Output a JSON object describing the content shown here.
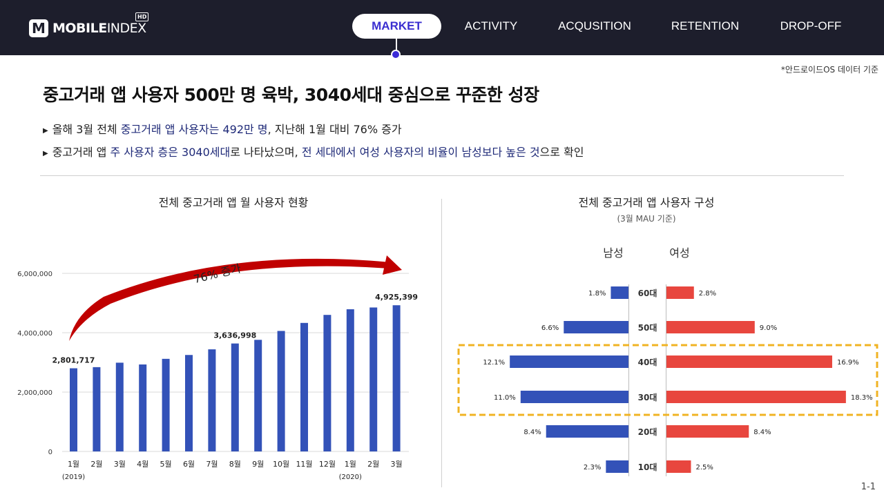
{
  "brand": {
    "name_bold": "MOBILE",
    "name_light": "INDEX",
    "badge": "HD",
    "mark": "M"
  },
  "nav": [
    "MARKET",
    "ACTIVITY",
    "ACQUSITION",
    "RETENTION",
    "DROP-OFF"
  ],
  "note": "*안드로이드OS 데이터 기준",
  "headline": "중고거래 앱 사용자 500만 명 육박, 3040세대 중심으로 꾸준한 성장",
  "bullets": [
    {
      "p1": "올해 3월 전체 ",
      "h1": "중고거래 앱 사용자는 492만 명",
      "p2": ", 지난해 1월 대비 76% 증가"
    },
    {
      "p1": "중고거래 앱  ",
      "h1": "주 사용자 층은 3040세대",
      "p2": "로 나타났으며, ",
      "h2": "전 세대에서 여성 사용자의 비율이 남성보다 높은 것",
      "p3": "으로 확인"
    }
  ],
  "page_number": "1-1",
  "colors": {
    "bar_blue": "#3352b8",
    "bar_red": "#e8463e",
    "highlight_box": "#f0b323",
    "arrow": "#c00000"
  },
  "chart_data": [
    {
      "type": "bar",
      "title": "전체 중고거래 앱 월 사용자 현황",
      "categories": [
        "1월",
        "2월",
        "3월",
        "4월",
        "5월",
        "6월",
        "7월",
        "8월",
        "9월",
        "10월",
        "11월",
        "12월",
        "1월",
        "2월",
        "3월"
      ],
      "year_labels": [
        "(2019)",
        "(2020)"
      ],
      "values": [
        2801717,
        2840000,
        2990000,
        2930000,
        3120000,
        3250000,
        3440000,
        3636998,
        3760000,
        4060000,
        4330000,
        4600000,
        4790000,
        4850000,
        4925399
      ],
      "data_labels": [
        "2,801,717",
        "3,636,998",
        "4,925,399"
      ],
      "ylim": [
        0,
        6000000
      ],
      "yticks": [
        "0",
        "2,000,000",
        "4,000,000",
        "6,000,000"
      ],
      "annotation": "76% 증가"
    },
    {
      "type": "bar",
      "title": "전체 중고거래 앱 사용자 구성",
      "subtitle": "(3월 MAU 기준)",
      "categories": [
        "60대",
        "50대",
        "40대",
        "30대",
        "20대",
        "10대"
      ],
      "series": [
        {
          "name": "남성",
          "values": [
            1.8,
            6.6,
            12.1,
            11.0,
            8.4,
            2.3
          ],
          "labels": [
            "1.8%",
            "6.6%",
            "12.1%",
            "11.0%",
            "8.4%",
            "2.3%"
          ]
        },
        {
          "name": "여성",
          "values": [
            2.8,
            9.0,
            16.9,
            18.3,
            8.4,
            2.5
          ],
          "labels": [
            "2.8%",
            "9.0%",
            "16.9%",
            "18.3%",
            "8.4%",
            "2.5%"
          ]
        }
      ],
      "highlighted": [
        "40대",
        "30대"
      ]
    }
  ]
}
